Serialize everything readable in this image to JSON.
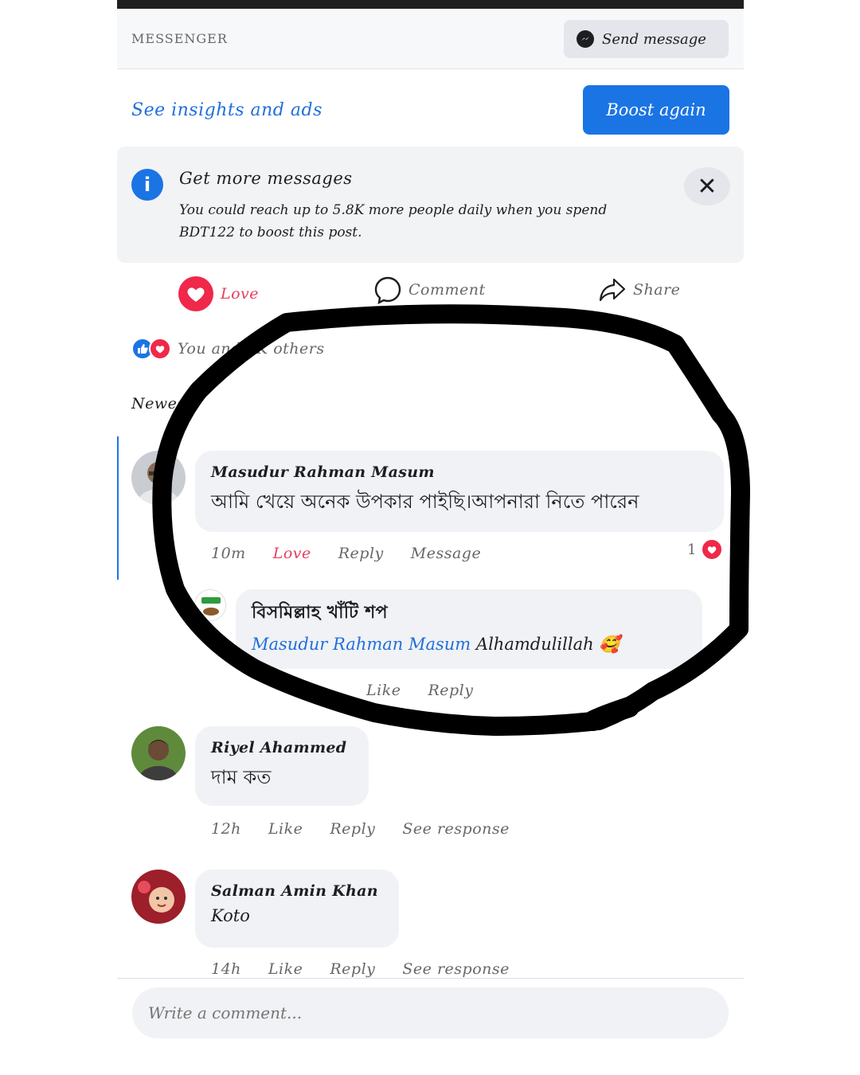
{
  "messenger": {
    "label": "MESSENGER",
    "send_button": "Send message"
  },
  "insights": {
    "link": "See insights and ads",
    "boost_button": "Boost again"
  },
  "tip": {
    "title": "Get more messages",
    "body": "You could reach up to 5.8K more people daily when you spend BDT122 to boost this post."
  },
  "actions": {
    "love": "Love",
    "comment": "Comment",
    "share": "Share"
  },
  "reactions": {
    "summary": "You and 3K others"
  },
  "sort": {
    "label": "Newest"
  },
  "comments": [
    {
      "author": "Masudur Rahman Masum",
      "text": "আমি খেয়ে অনেক উপকার পাইছি।আপনারা নিতে পারেন",
      "time": "10m",
      "love": "Love",
      "reply": "Reply",
      "message": "Message",
      "reaction_count": "1",
      "replies": [
        {
          "author": "বিসমিল্লাহ খাঁটি শপ",
          "mention": "Masudur Rahman Masum",
          "text": "Alhamdulillah",
          "emoji": "🥰",
          "like": "Like",
          "reply": "Reply"
        }
      ]
    },
    {
      "author": "Riyel Ahammed",
      "text": "দাম কত",
      "time": "12h",
      "like": "Like",
      "reply": "Reply",
      "see_response": "See response"
    },
    {
      "author": "Salman Amin Khan",
      "text": "Koto",
      "time": "14h",
      "like": "Like",
      "reply": "Reply",
      "see_response": "See response"
    }
  ],
  "composer": {
    "placeholder": "Write a comment..."
  },
  "colors": {
    "accent": "#1b74e4",
    "love": "#e4405f",
    "bubble": "#f0f2f5",
    "scribble": "#000000"
  }
}
